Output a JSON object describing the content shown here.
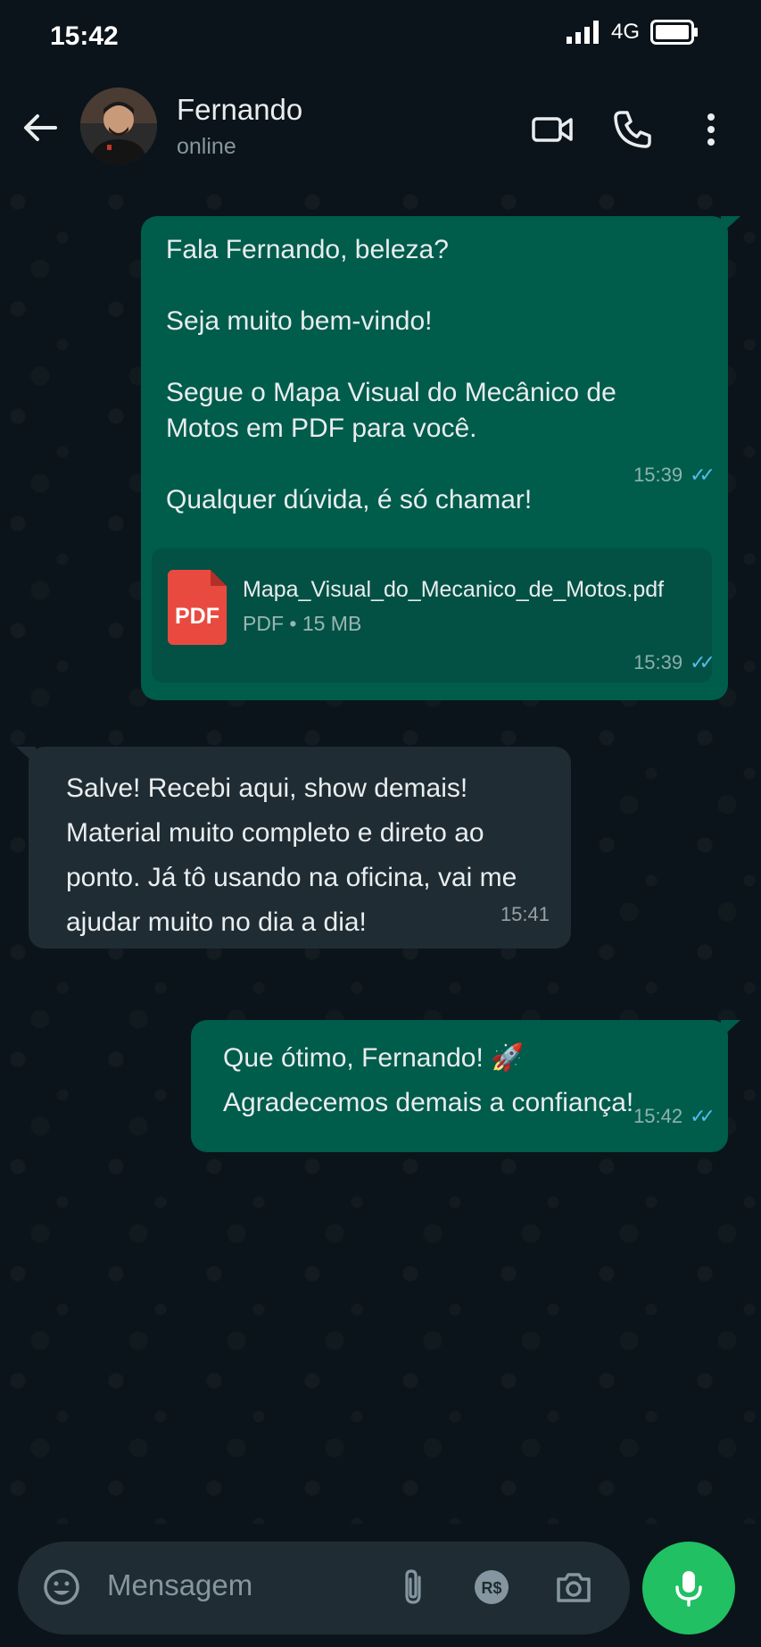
{
  "status_bar": {
    "time": "15:42",
    "network": "4G"
  },
  "header": {
    "contact_name": "Fernando",
    "contact_status": "online",
    "icons": [
      "back-arrow-icon",
      "video-call-icon",
      "phone-icon",
      "more-vertical-icon"
    ]
  },
  "messages": [
    {
      "direction": "out",
      "text": "Fala Fernando, beleza?\n\nSeja muito bem-vindo!\n\nSegue o Mapa Visual do Mecânico de\nMotos em PDF para você.\n\nQualquer dúvida, é só chamar!",
      "time": "15:39",
      "status": "read"
    },
    {
      "direction": "out",
      "document": {
        "icon_label": "PDF",
        "file_name": "Mapa_Visual_do_Mecanico_de_Motos.pdf",
        "info": "PDF • 15 MB"
      },
      "time": "15:39",
      "status": "read"
    },
    {
      "direction": "in",
      "text": "Salve! Recebi aqui, show demais!\nMaterial muito completo e direto ao\nponto. Já tô usando na oficina, vai me\najudar muito no dia a dia!",
      "time": "15:41"
    },
    {
      "direction": "out",
      "text": "Que ótimo, Fernando! 🚀\nAgradecemos demais a confiança!",
      "time": "15:42",
      "status": "read"
    }
  ],
  "input_bar": {
    "placeholder": "Mensagem",
    "icons": [
      "emoji-icon",
      "attach-icon",
      "payment-icon",
      "camera-icon",
      "mic-icon"
    ]
  },
  "colors": {
    "background": "#0b141a",
    "outgoing_bubble": "#005c4b",
    "incoming_bubble": "#1f2c33",
    "read_ticks": "#53bdeb",
    "mic_button": "#21c063"
  }
}
